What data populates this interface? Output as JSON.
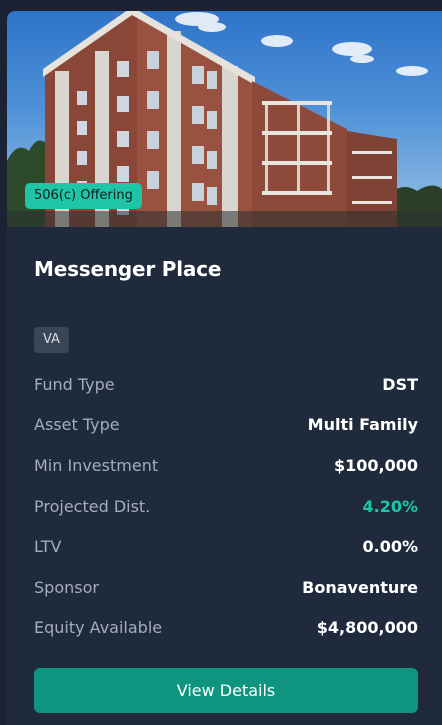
{
  "listing": {
    "badge": "506(c) Offering",
    "title": "Messenger Place",
    "state_tag": "VA",
    "details": [
      {
        "label": "Fund Type",
        "value": "DST"
      },
      {
        "label": "Asset Type",
        "value": "Multi Family"
      },
      {
        "label": "Min Investment",
        "value": "$100,000"
      },
      {
        "label": "Projected Dist.",
        "value": "4.20%"
      },
      {
        "label": "LTV",
        "value": "0.00%"
      },
      {
        "label": "Sponsor",
        "value": "Bonaventure"
      },
      {
        "label": "Equity Available",
        "value": "$4,800,000"
      }
    ],
    "cta_label": "View Details"
  },
  "colors": {
    "background": "#1a2233",
    "card": "#1f2a3c",
    "accent": "#1ec6a7",
    "button": "#0f9480",
    "tag": "#3a4556"
  }
}
